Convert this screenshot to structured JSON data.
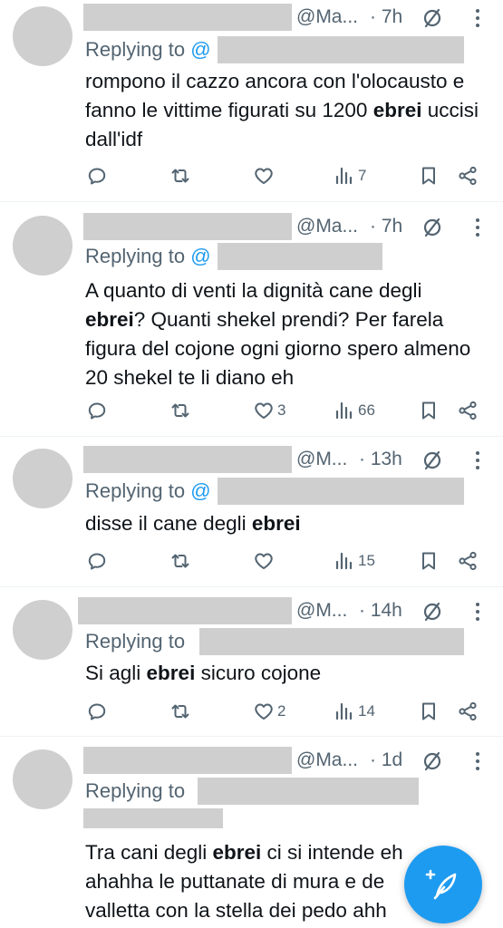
{
  "tweets": [
    {
      "handle": "@Ma...",
      "time": "· 7h",
      "replying_prefix": "Replying to",
      "replying_at": "@",
      "body": [
        {
          "t": "rompono il cazzo ancora con l'olocausto e fanno le vittime figurati su 1200 "
        },
        {
          "t": "ebrei",
          "b": true
        },
        {
          "t": " uccisi dall'idf"
        }
      ],
      "likes": "",
      "views": "7"
    },
    {
      "handle": "@Ma...",
      "time": "· 7h",
      "replying_prefix": "Replying to",
      "replying_at": "@",
      "body": [
        {
          "t": "A quanto di venti la dignità cane degli "
        },
        {
          "t": "ebrei",
          "b": true
        },
        {
          "t": "? Quanti shekel prendi? Per farela figura del cojone ogni giorno spero almeno 20 shekel te li diano eh"
        }
      ],
      "likes": "3",
      "views": "66"
    },
    {
      "handle": "@M...",
      "time": "· 13h",
      "replying_prefix": "Replying to",
      "replying_at": "@",
      "body": [
        {
          "t": "disse il cane degli "
        },
        {
          "t": "ebrei",
          "b": true
        }
      ],
      "likes": "",
      "views": "15"
    },
    {
      "handle": "@M...",
      "time": "· 14h",
      "replying_prefix": "Replying to",
      "replying_at": "",
      "body": [
        {
          "t": "Si agli "
        },
        {
          "t": "ebrei",
          "b": true
        },
        {
          "t": " sicuro cojone"
        }
      ],
      "likes": "2",
      "views": "14"
    },
    {
      "handle": "@Ma...",
      "time": "· 1d",
      "replying_prefix": "Replying to",
      "replying_at": "",
      "body": [
        {
          "t": "Tra cani degli "
        },
        {
          "t": "ebrei",
          "b": true
        },
        {
          "t": " ci si intende eh ahahha le puttanate di mura e de valletta con la stella dei pedo ahh"
        }
      ],
      "likes": "",
      "views": ""
    }
  ],
  "icons": {
    "reply": "reply-icon",
    "retweet": "retweet-icon",
    "like": "like-icon",
    "views": "views-icon",
    "bookmark": "bookmark-icon",
    "share": "share-icon",
    "grok": "grok-icon",
    "more": "more-icon",
    "compose": "compose-icon"
  },
  "colors": {
    "accent": "#1d9bf0",
    "muted": "#536471",
    "text": "#0f1419",
    "redaction": "#cfcfcf"
  }
}
